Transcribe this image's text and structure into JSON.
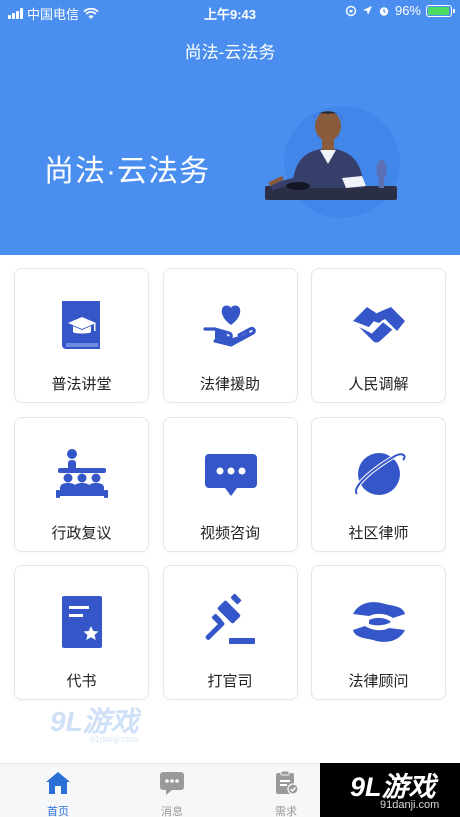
{
  "status_bar": {
    "carrier": "中国电信",
    "time": "上午9:43",
    "battery": "96%",
    "battery_level": 0.96
  },
  "header": {
    "nav_title": "尚法-云法务",
    "banner_title": "尚法·云法务"
  },
  "services": [
    {
      "label": "普法讲堂",
      "icon": "book-graduation-icon"
    },
    {
      "label": "法律援助",
      "icon": "heart-hand-icon"
    },
    {
      "label": "人民调解",
      "icon": "handshake-icon"
    },
    {
      "label": "行政复议",
      "icon": "meeting-icon"
    },
    {
      "label": "视频咨询",
      "icon": "chat-bubble-icon"
    },
    {
      "label": "社区律师",
      "icon": "planet-icon"
    },
    {
      "label": "代书",
      "icon": "document-star-icon"
    },
    {
      "label": "打官司",
      "icon": "gavel-icon"
    },
    {
      "label": "法律顾问",
      "icon": "hands-care-icon"
    }
  ],
  "tabbar": {
    "items": [
      {
        "label": "首页",
        "icon": "home-icon",
        "active": true
      },
      {
        "label": "消息",
        "icon": "message-icon",
        "active": false
      },
      {
        "label": "需求",
        "icon": "clipboard-icon",
        "active": false
      }
    ]
  },
  "watermark": {
    "logo": "9L游戏",
    "site": "91danji.com"
  },
  "colors": {
    "header_bg": "#4a8ff0",
    "icon_blue": "#3556c8",
    "active_tab": "#2b6fd6"
  }
}
